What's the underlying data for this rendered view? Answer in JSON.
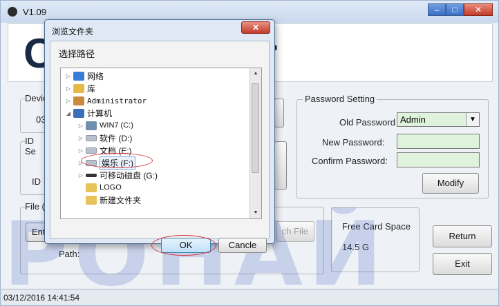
{
  "window": {
    "title": "V1.09",
    "minimize": "–",
    "maximize": "□",
    "close": "✕"
  },
  "banner": {
    "visible_text": "C                r"
  },
  "device_group": {
    "legend": "Devic",
    "value": "03"
  },
  "id_group": {
    "legend": "ID Se",
    "label": "ID"
  },
  "password_setting": {
    "legend": "Password Setting",
    "old_password_label": "Old Password",
    "old_password_value": "Admin",
    "new_password_label": "New Password:",
    "confirm_password_label": "Confirm Password:",
    "modify_button": "Modify"
  },
  "file_group": {
    "legend": "File (",
    "enter_button": "Ent",
    "search_button": "ch File",
    "path_label": "Path:"
  },
  "free_space": {
    "label": "Free Card Space",
    "value": "14.5 G"
  },
  "buttons": {
    "return": "Return",
    "exit": "Exit"
  },
  "status_bar": {
    "datetime": "03/12/2016 14:41:54"
  },
  "watermark": {
    "text": "POHAЙ"
  },
  "dialog": {
    "title": "浏览文件夹",
    "close": "✕",
    "prompt": "选择路径",
    "tree": [
      {
        "label": "网络",
        "icon": "network-icon",
        "expander": "▷"
      },
      {
        "label": "库",
        "icon": "library-icon",
        "expander": "▷"
      },
      {
        "label": "Administrator",
        "icon": "user-folder-icon",
        "expander": "▷"
      },
      {
        "label": "计算机",
        "icon": "computer-icon",
        "expander": "◢"
      },
      {
        "label": "WIN7 (C:)",
        "icon": "system-drive-icon",
        "expander": "▷"
      },
      {
        "label": "软件 (D:)",
        "icon": "drive-icon",
        "expander": "▷"
      },
      {
        "label": "文档 (E:)",
        "icon": "drive-icon",
        "expander": "▷"
      },
      {
        "label": "娱乐 (F:)",
        "icon": "drive-icon",
        "expander": "▷",
        "selected": true
      },
      {
        "label": "可移动磁盘 (G:)",
        "icon": "usb-drive-icon",
        "expander": "▷"
      },
      {
        "label": "LOGO",
        "icon": "folder-icon",
        "expander": ""
      },
      {
        "label": "新建文件夹",
        "icon": "folder-icon",
        "expander": ""
      }
    ],
    "ok_button": "OK",
    "cancel_button": "Cancle"
  },
  "colors": {
    "input_bg": "#dff2dc",
    "highlight_oval": "#d9343b",
    "watermark": "#4060c0"
  }
}
